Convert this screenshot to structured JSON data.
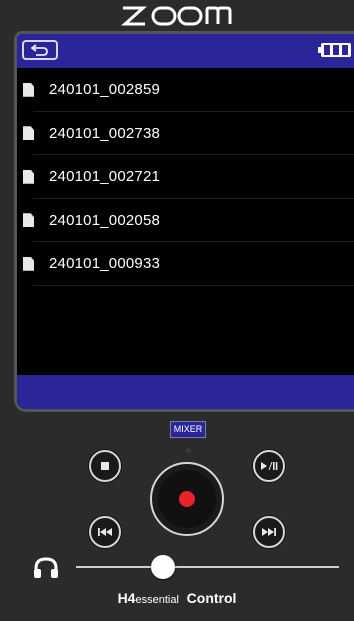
{
  "header": {
    "logo_text": "ZOOM"
  },
  "screen": {
    "back_icon": "back-arrow-icon",
    "battery_icon": "battery-full-icon",
    "files": [
      {
        "name": "240101_002859"
      },
      {
        "name": "240101_002738"
      },
      {
        "name": "240101_002721"
      },
      {
        "name": "240101_002058"
      },
      {
        "name": "240101_000933"
      }
    ]
  },
  "controls": {
    "mixer_label": "MIXER",
    "stop_icon": "stop-icon",
    "play_pause_icon": "play-pause-icon",
    "rewind_icon": "rewind-icon",
    "fast_forward_icon": "fast-forward-icon",
    "record_icon": "record-icon"
  },
  "volume": {
    "icon": "headphones-icon",
    "level": 0.33
  },
  "footer": {
    "model_bold": "H4",
    "model_small": "essential",
    "app_bold": "Control"
  },
  "colors": {
    "accent": "#2b259a",
    "record": "#e8232a",
    "background": "#2b2b2b"
  }
}
